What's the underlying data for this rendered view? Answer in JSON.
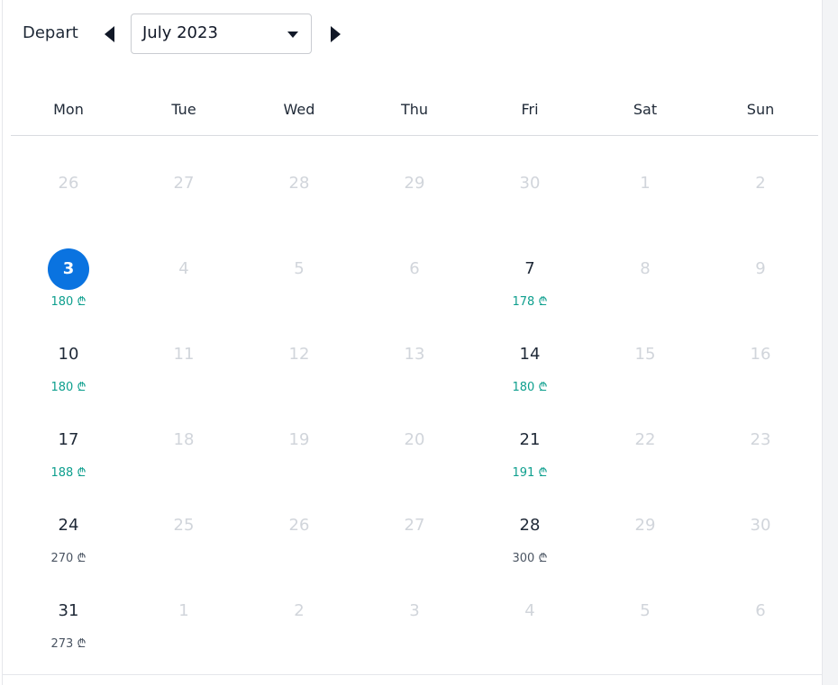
{
  "header": {
    "depart_label": "Depart",
    "month_value": "July 2023"
  },
  "weekdays": [
    "Mon",
    "Tue",
    "Wed",
    "Thu",
    "Fri",
    "Sat",
    "Sun"
  ],
  "currency_symbol": "₾",
  "colors": {
    "selected": "#0a73e0",
    "price_low": "#0e9f8e",
    "price_normal": "#4b5563",
    "muted_day": "#d1d5db"
  },
  "weeks": [
    [
      {
        "day": "26",
        "state": "muted"
      },
      {
        "day": "27",
        "state": "muted"
      },
      {
        "day": "28",
        "state": "muted"
      },
      {
        "day": "29",
        "state": "muted"
      },
      {
        "day": "30",
        "state": "muted"
      },
      {
        "day": "1",
        "state": "muted"
      },
      {
        "day": "2",
        "state": "muted"
      }
    ],
    [
      {
        "day": "3",
        "state": "selected",
        "price": "180",
        "price_tone": "teal"
      },
      {
        "day": "4",
        "state": "muted"
      },
      {
        "day": "5",
        "state": "muted"
      },
      {
        "day": "6",
        "state": "muted"
      },
      {
        "day": "7",
        "state": "avail",
        "price": "178",
        "price_tone": "teal"
      },
      {
        "day": "8",
        "state": "muted"
      },
      {
        "day": "9",
        "state": "muted"
      }
    ],
    [
      {
        "day": "10",
        "state": "avail",
        "price": "180",
        "price_tone": "teal"
      },
      {
        "day": "11",
        "state": "muted"
      },
      {
        "day": "12",
        "state": "muted"
      },
      {
        "day": "13",
        "state": "muted"
      },
      {
        "day": "14",
        "state": "avail",
        "price": "180",
        "price_tone": "teal"
      },
      {
        "day": "15",
        "state": "muted"
      },
      {
        "day": "16",
        "state": "muted"
      }
    ],
    [
      {
        "day": "17",
        "state": "avail",
        "price": "188",
        "price_tone": "teal"
      },
      {
        "day": "18",
        "state": "muted"
      },
      {
        "day": "19",
        "state": "muted"
      },
      {
        "day": "20",
        "state": "muted"
      },
      {
        "day": "21",
        "state": "avail",
        "price": "191",
        "price_tone": "teal"
      },
      {
        "day": "22",
        "state": "muted"
      },
      {
        "day": "23",
        "state": "muted"
      }
    ],
    [
      {
        "day": "24",
        "state": "avail",
        "price": "270",
        "price_tone": "grey"
      },
      {
        "day": "25",
        "state": "muted"
      },
      {
        "day": "26",
        "state": "muted"
      },
      {
        "day": "27",
        "state": "muted"
      },
      {
        "day": "28",
        "state": "avail",
        "price": "300",
        "price_tone": "grey"
      },
      {
        "day": "29",
        "state": "muted"
      },
      {
        "day": "30",
        "state": "muted"
      }
    ],
    [
      {
        "day": "31",
        "state": "avail",
        "price": "273",
        "price_tone": "grey"
      },
      {
        "day": "1",
        "state": "muted"
      },
      {
        "day": "2",
        "state": "muted"
      },
      {
        "day": "3",
        "state": "muted"
      },
      {
        "day": "4",
        "state": "muted"
      },
      {
        "day": "5",
        "state": "muted"
      },
      {
        "day": "6",
        "state": "muted"
      }
    ]
  ]
}
